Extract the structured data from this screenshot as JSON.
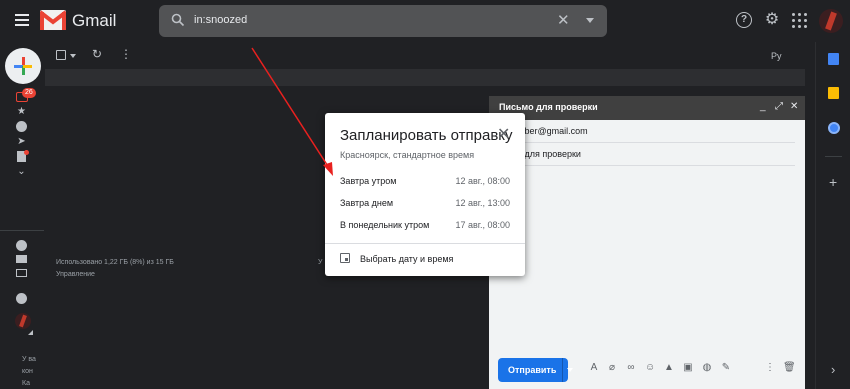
{
  "app": {
    "title": "Gmail"
  },
  "search": {
    "query": "in:snoozed"
  },
  "rail": {
    "inbox_badge": "26",
    "bottom_text": [
      "У ва",
      "кон",
      "Ка"
    ]
  },
  "toolbar": {
    "lang": "Ру"
  },
  "footer": {
    "storage": "Использовано 1,22 ГБ (8%) из 15 ГБ",
    "manage": "Управление",
    "fragment": "У"
  },
  "compose": {
    "title": "Письмо для проверки",
    "to_fragment": "...ber@gmail.com",
    "subject_fragment": "о для проверки",
    "body_fragment": "",
    "send_label": "Отправить"
  },
  "dialog": {
    "title": "Запланировать отправку",
    "subtitle": "Красноярск, стандартное время",
    "options": [
      {
        "label": "Завтра утром",
        "time": "12 авг., 08:00"
      },
      {
        "label": "Завтра днем",
        "time": "12 авг., 13:00"
      },
      {
        "label": "В понедельник утром",
        "time": "17 авг., 08:00"
      }
    ],
    "pick_label": "Выбрать дату и время"
  },
  "colors": {
    "accent": "#1a73e8",
    "arrow": "#e8211f",
    "gmail_red": "#ea4335"
  }
}
